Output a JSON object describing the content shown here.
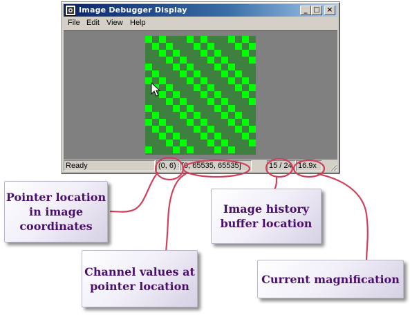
{
  "window": {
    "title": "Image Debugger Display",
    "controls": {
      "minimize": "_",
      "maximize": "□",
      "close": "×"
    }
  },
  "menu": {
    "items": [
      "File",
      "Edit",
      "View",
      "Help"
    ]
  },
  "canvas": {
    "background_color": "#808080",
    "checker_dark_color": "#3f7f3f",
    "checker_bright_color": "#00ff00"
  },
  "statusbar": {
    "status": "Ready",
    "pointer_location": "(0, 6) =",
    "channel_values": "[0, 65535, 65535]",
    "history": "15 / 24",
    "magnification": "16.9x"
  },
  "annotations": {
    "pointer_location": "Pointer location in image coordinates",
    "channel_values": "Channel values at pointer location",
    "image_history": "Image history buffer location",
    "magnification": "Current magnification",
    "line_color": "#d0405a",
    "text_color": "#4b0f6e"
  }
}
